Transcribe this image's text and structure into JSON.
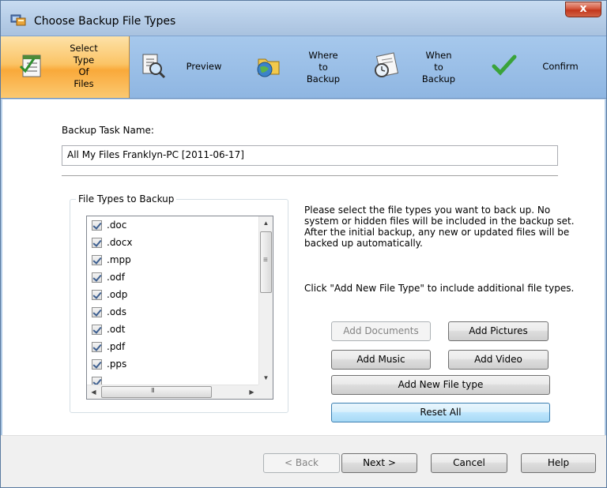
{
  "window": {
    "title": "Choose Backup File Types",
    "close_label": "x"
  },
  "steps": [
    {
      "label": "Select\nType\nOf\nFiles",
      "icon": "checklist-icon",
      "active": true
    },
    {
      "label": "Preview",
      "icon": "preview-icon",
      "active": false
    },
    {
      "label": "Where\nto\nBackup",
      "icon": "folder-globe-icon",
      "active": false
    },
    {
      "label": "When\nto\nBackup",
      "icon": "calendar-clock-icon",
      "active": false
    },
    {
      "label": "Confirm",
      "icon": "checkmark-icon",
      "active": false
    }
  ],
  "task": {
    "label": "Backup Task Name:",
    "value": "All My Files  Franklyn-PC [2011-06-17]"
  },
  "file_types": {
    "legend": "File Types to Backup",
    "items": [
      ".doc",
      ".docx",
      ".mpp",
      ".odf",
      ".odp",
      ".ods",
      ".odt",
      ".pdf",
      ".pps"
    ]
  },
  "description": {
    "text1": "Please select the file types you want to back up. No system or hidden files will be included in the backup set. After the initial backup, any new or updated files will be backed up automatically.",
    "text2": "Click \"Add New File Type\" to include additional file types."
  },
  "buttons": {
    "add_documents": "Add Documents",
    "add_pictures": "Add Pictures",
    "add_music": "Add Music",
    "add_video": "Add Video",
    "add_new_file_type": "Add New File type",
    "reset_all": "Reset All"
  },
  "footer": {
    "back": "< Back",
    "next": "Next >",
    "cancel": "Cancel",
    "help": "Help"
  },
  "colors": {
    "active_step": "#f9a93a",
    "step_bar": "#a6c8ec",
    "close_button": "#c2371c"
  }
}
